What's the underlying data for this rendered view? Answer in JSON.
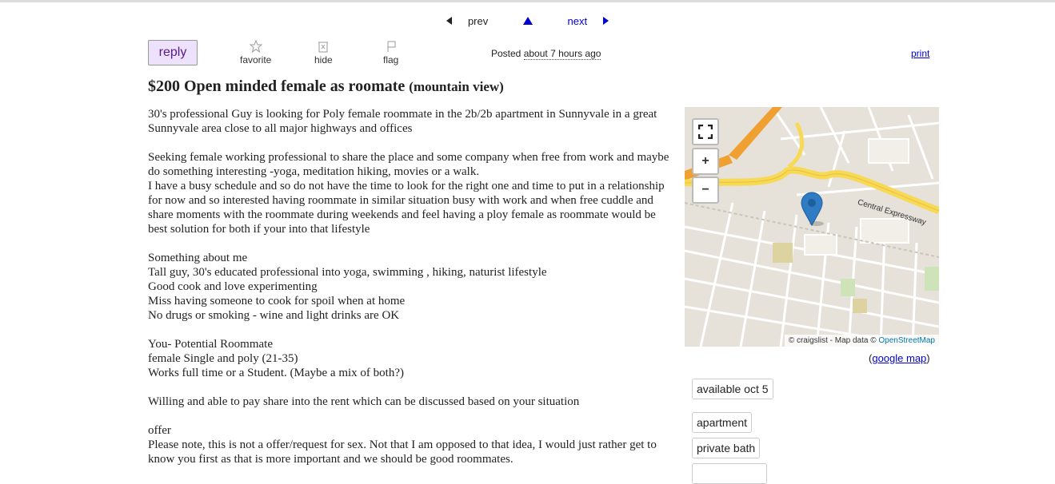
{
  "nav": {
    "prev": "prev",
    "next": "next"
  },
  "actions": {
    "reply": "reply",
    "favorite": "favorite",
    "hide": "hide",
    "flag": "flag"
  },
  "posted": {
    "label": "Posted",
    "time": "about 7 hours ago"
  },
  "print": "print",
  "title": {
    "price": "$200",
    "text": "Open minded female as roomate",
    "hood": "(mountain view)"
  },
  "body": [
    "30's professional Guy is looking for Poly female roommate in the 2b/2b apartment in Sunnyvale in a great Sunnyvale area close to all major highways and offices",
    "",
    "Seeking female working professional to share the place and some company when free from work and maybe do something interesting -yoga, meditation hiking, movies or a walk.",
    "I have a busy schedule and so do not have the time to look for the right one and time to put in a relationship for now and so interested having roommate in similar situation busy with work and when free cuddle and share moments with the roommate during weekends and feel having a ploy female as roommate would be best solution for both if your into that lifestyle",
    "",
    "Something about me",
    "Tall guy, 30's educated professional into yoga, swimming , hiking, naturist lifestyle",
    "Good cook and love experimenting",
    "Miss having someone to cook for spoil when at home",
    "No drugs or smoking - wine and light drinks are OK",
    "",
    "You- Potential Roommate",
    "female Single and poly (21-35)",
    "Works full time or a Student. (Maybe a mix of both?)",
    "",
    "Willing and able to pay share into the rent which can be discussed based on your situation",
    "",
    "offer",
    "Please note, this is not a offer/request for sex. Not that I am opposed to that idea, I would just rather get to know you first as that is more important and we should be good roommates."
  ],
  "map": {
    "road_label": "Central Expressway",
    "attribution": "© craigslist - Map data ©",
    "osm": "OpenStreetMap",
    "zoom_in": "+",
    "zoom_out": "−",
    "google_open": "(",
    "google_link": "google map",
    "google_close": ")"
  },
  "attributes": [
    "available oct 5",
    "apartment",
    "private bath"
  ],
  "colors": {
    "link": "#0000cc",
    "reply_bg": "#eee1fb",
    "reply_text": "#551a8b",
    "highway": "#f0a030",
    "expressway": "#f7d956",
    "marker": "#2f7bc4"
  }
}
